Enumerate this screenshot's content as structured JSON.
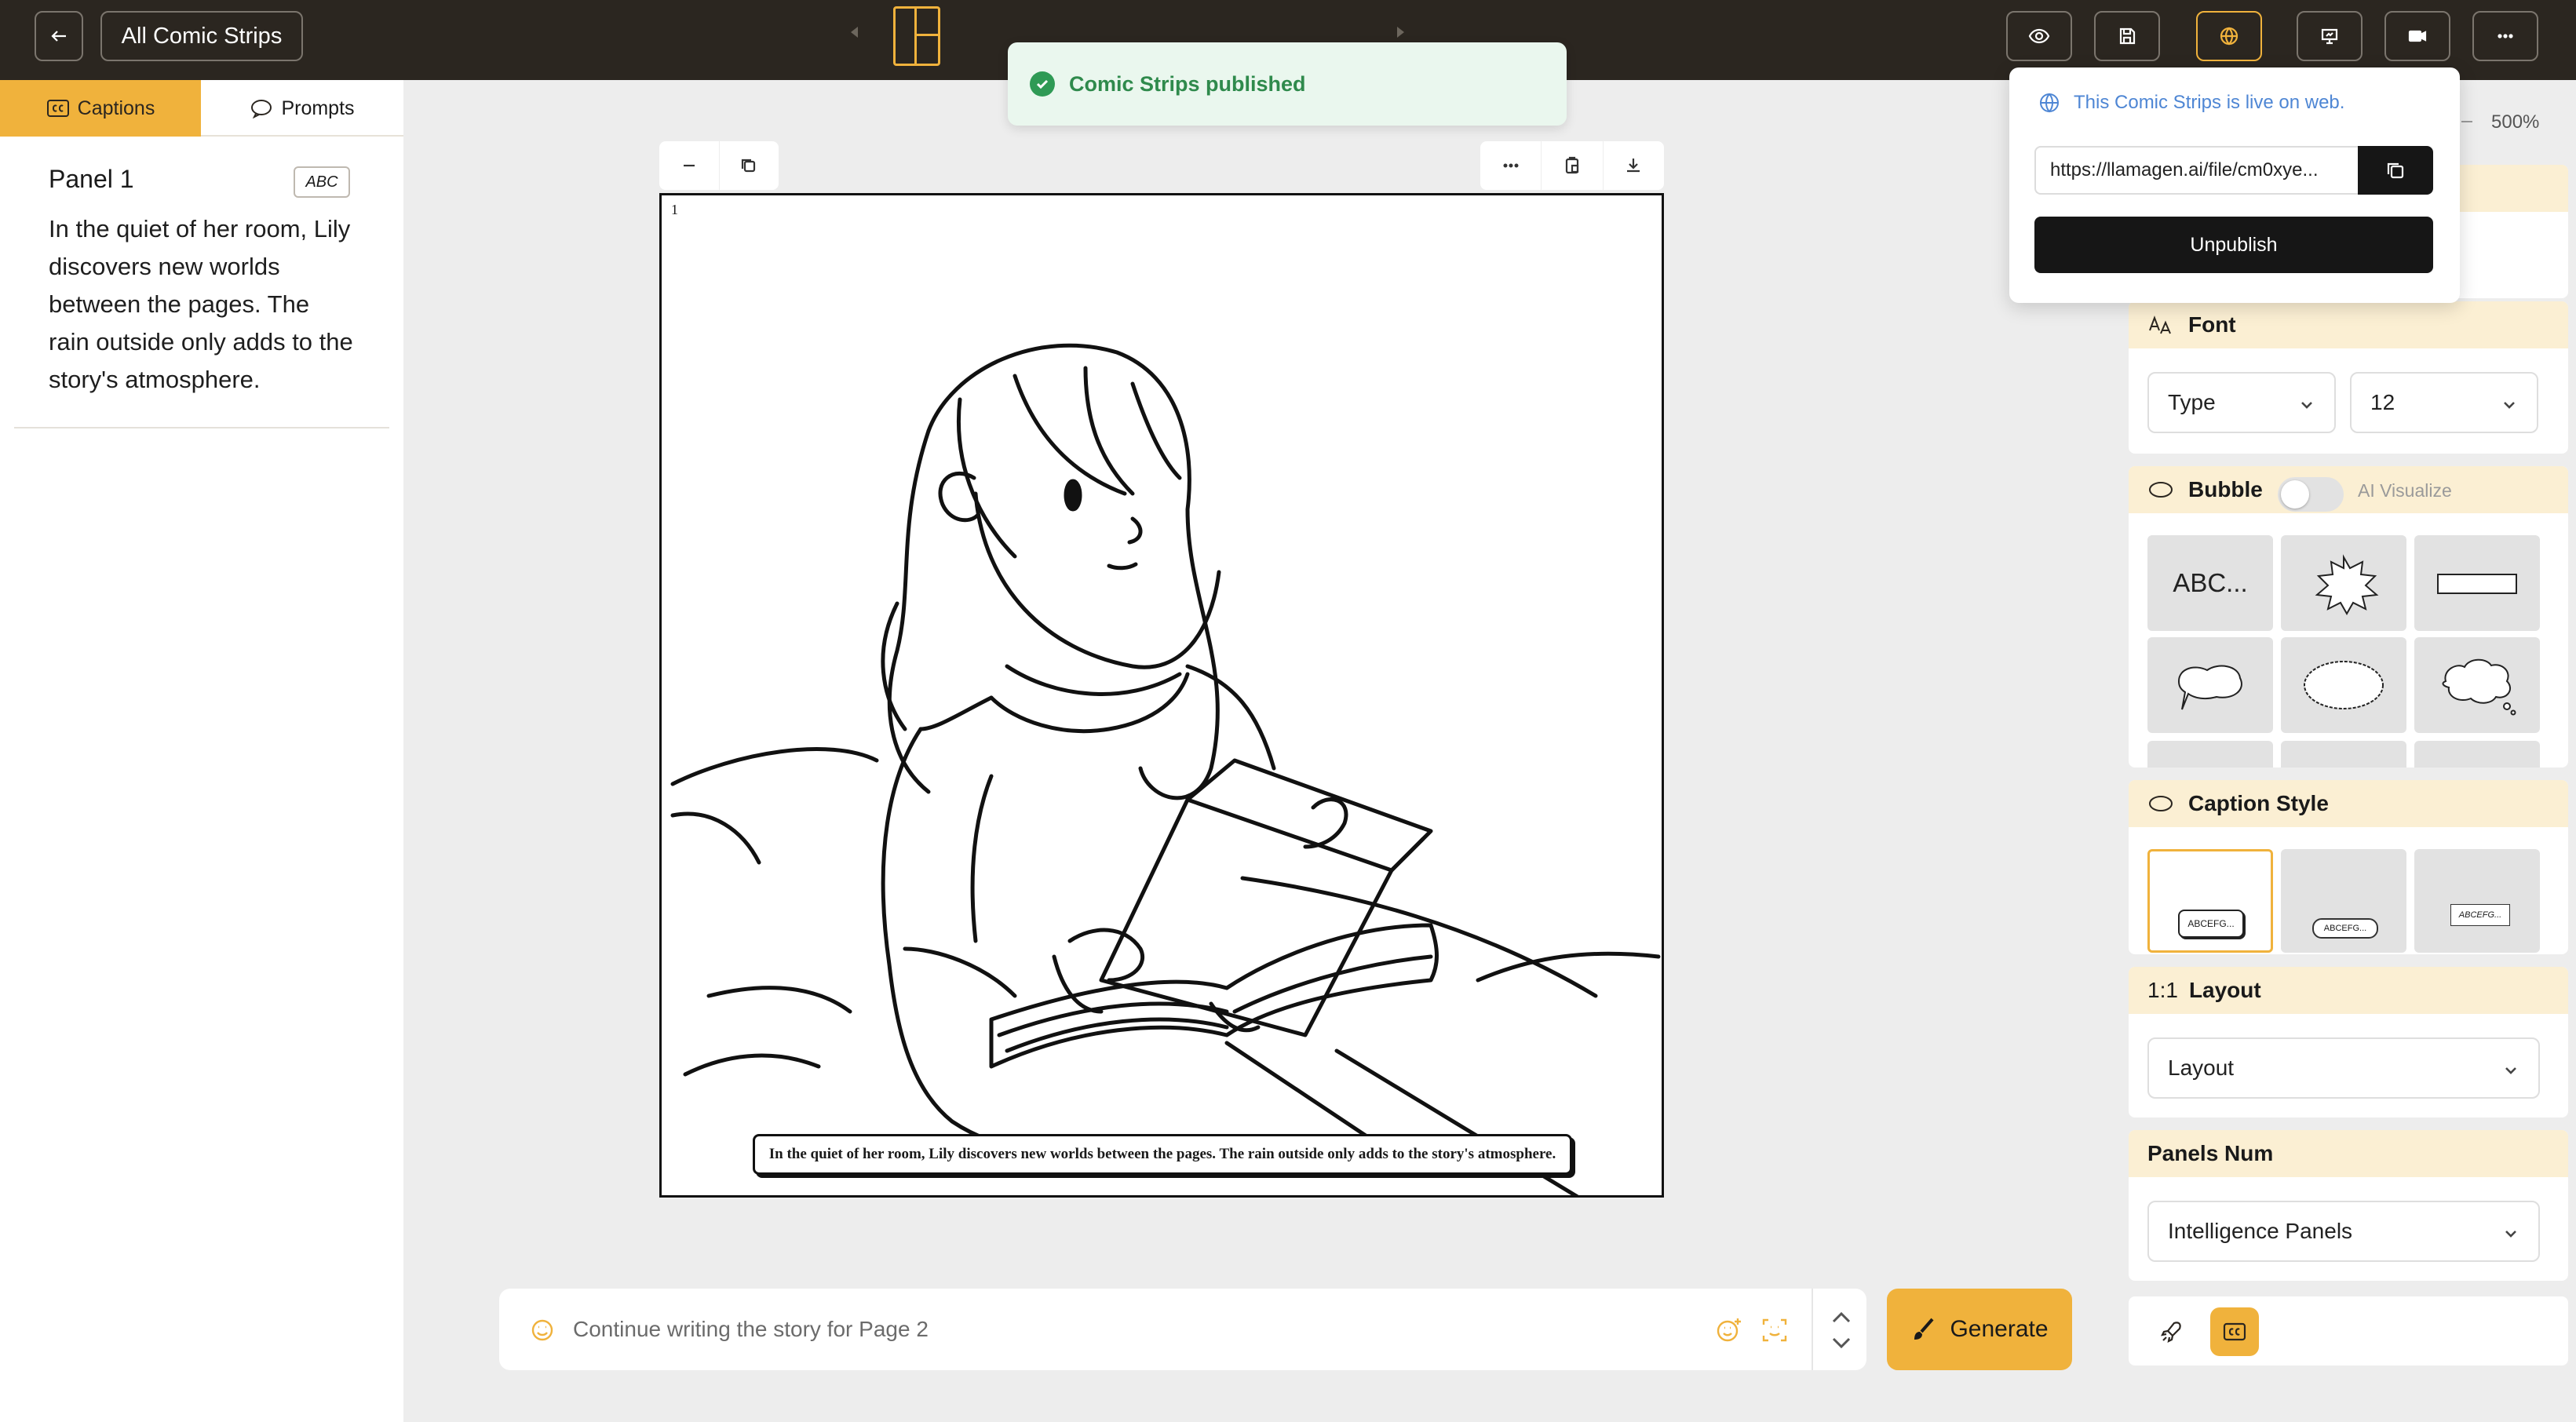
{
  "topbar": {
    "all_label": "All Comic Strips"
  },
  "toast": {
    "message": "Comic Strips published"
  },
  "left": {
    "tabs": [
      {
        "label": "Captions",
        "active": true
      },
      {
        "label": "Prompts",
        "active": false
      }
    ],
    "panel_title": "Panel 1",
    "badge": "ABC",
    "caption": "In the quiet of her room, Lily discovers new worlds between the pages. The rain outside only adds to the story's atmosphere."
  },
  "comic": {
    "panel_number": "1",
    "caption": "In the quiet of her room, Lily discovers new worlds between the pages. The rain outside only adds to the story's atmosphere."
  },
  "prompt": {
    "placeholder": "Continue writing the story for Page 2"
  },
  "generate_label": "Generate",
  "right": {
    "zoom": "500%",
    "font": {
      "title": "Font",
      "type_value": "Type",
      "size_value": "12"
    },
    "bubble": {
      "title": "Bubble",
      "ai_visualize": "AI Visualize",
      "abc_tile": "ABC..."
    },
    "caption_style": {
      "title": "Caption Style",
      "samples": [
        "ABCEFG...",
        "ABCEFG...",
        "ABCEFG..."
      ]
    },
    "layout": {
      "ratio": "1:1",
      "title": "Layout",
      "value": "Layout"
    },
    "panels_num": {
      "title": "Panels Num",
      "value": "Intelligence Panels"
    }
  },
  "publish": {
    "live_text": "This Comic Strips is live on web.",
    "url": "https://llamagen.ai/file/cm0xye...",
    "unpublish_label": "Unpublish"
  },
  "colors": {
    "accent": "#f0b23c",
    "topbar": "#2b2620",
    "success": "#2f8a4c",
    "link": "#4e86d4"
  }
}
